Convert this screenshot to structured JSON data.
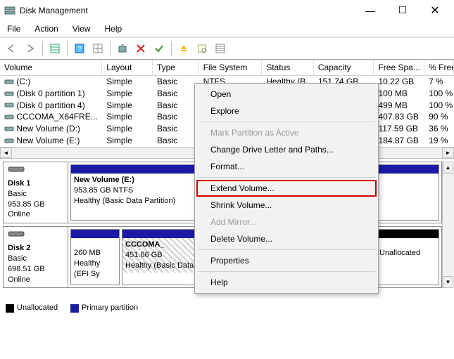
{
  "title": "Disk Management",
  "window_controls": {
    "min": "—",
    "max": "☐",
    "close": "✕"
  },
  "menu": [
    "File",
    "Action",
    "View",
    "Help"
  ],
  "columns": [
    "Volume",
    "Layout",
    "Type",
    "File System",
    "Status",
    "Capacity",
    "Free Spa...",
    "% Free"
  ],
  "rows": [
    {
      "vol": "(C:)",
      "layout": "Simple",
      "type": "Basic",
      "fs": "NTFS",
      "status": "Healthy (B...",
      "cap": "151.74 GB",
      "free": "10.22 GB",
      "pct": "7 %"
    },
    {
      "vol": "(Disk 0 partition 1)",
      "layout": "Simple",
      "type": "Basic",
      "fs": "",
      "status": "",
      "cap": "",
      "free": "100 MB",
      "pct": "100 %"
    },
    {
      "vol": "(Disk 0 partition 4)",
      "layout": "Simple",
      "type": "Basic",
      "fs": "",
      "status": "",
      "cap": "",
      "free": "499 MB",
      "pct": "100 %"
    },
    {
      "vol": "CCCOMA_X64FRE...",
      "layout": "Simple",
      "type": "Basic",
      "fs": "",
      "status": "",
      "cap": "",
      "free": "407.83 GB",
      "pct": "90 %"
    },
    {
      "vol": "New Volume (D:)",
      "layout": "Simple",
      "type": "Basic",
      "fs": "",
      "status": "",
      "cap": "",
      "free": "117.59 GB",
      "pct": "36 %"
    },
    {
      "vol": "New Volume (E:)",
      "layout": "Simple",
      "type": "Basic",
      "fs": "",
      "status": "",
      "cap": "",
      "free": "184.87 GB",
      "pct": "19 %"
    }
  ],
  "disks": {
    "d1": {
      "name": "Disk 1",
      "type": "Basic",
      "size": "953.85 GB",
      "state": "Online",
      "p1_title": "New Volume  (E:)",
      "p1_sub": "953.85 GB NTFS",
      "p1_health": "Healthy (Basic Data Partition)"
    },
    "d2": {
      "name": "Disk 2",
      "type": "Basic",
      "size": "698.51 GB",
      "state": "Online",
      "p1_sub": "260 MB",
      "p1_health": "Healthy (EFI Sy",
      "p2_title": "CCCOMA_",
      "p2_sub": "451.66 GB",
      "p2_health": "Healthy (Basic Data Partition)",
      "p3_title": "Unallocated"
    }
  },
  "legend": {
    "unalloc": "Unallocated",
    "primary": "Primary partition"
  },
  "ctx": {
    "open": "Open",
    "explore": "Explore",
    "mark": "Mark Partition as Active",
    "change": "Change Drive Letter and Paths...",
    "format": "Format...",
    "extend": "Extend Volume...",
    "shrink": "Shrink Volume...",
    "mirror": "Add Mirror...",
    "delete": "Delete Volume...",
    "props": "Properties",
    "help": "Help"
  }
}
